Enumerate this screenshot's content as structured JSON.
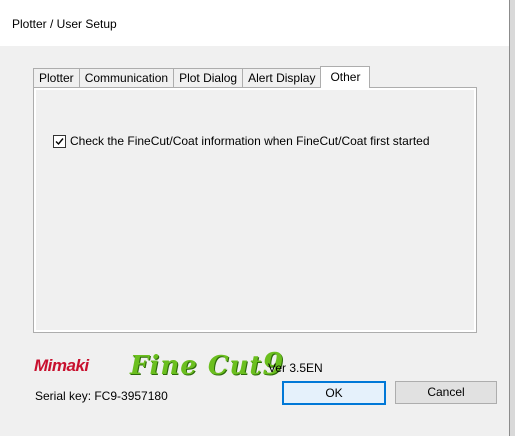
{
  "window": {
    "title": "Plotter / User Setup"
  },
  "tabs": [
    {
      "label": "Plotter"
    },
    {
      "label": "Communication"
    },
    {
      "label": "Plot Dialog"
    },
    {
      "label": "Alert Display"
    },
    {
      "label": "Other"
    }
  ],
  "active_tab": "Other",
  "other": {
    "check_label": "Check the FineCut/Coat information when FineCut/Coat first started",
    "checked": true
  },
  "footer": {
    "brand": "Mimaki",
    "product": "Fine Cut",
    "product_number": "9",
    "version": "Ver 3.5EN",
    "serial": "Serial key: FC9-3957180"
  },
  "buttons": {
    "ok": "OK",
    "cancel": "Cancel"
  },
  "colors": {
    "accent": "#0078d7",
    "brand_red": "#c8102e",
    "brand_green": "#6bbf1f"
  }
}
